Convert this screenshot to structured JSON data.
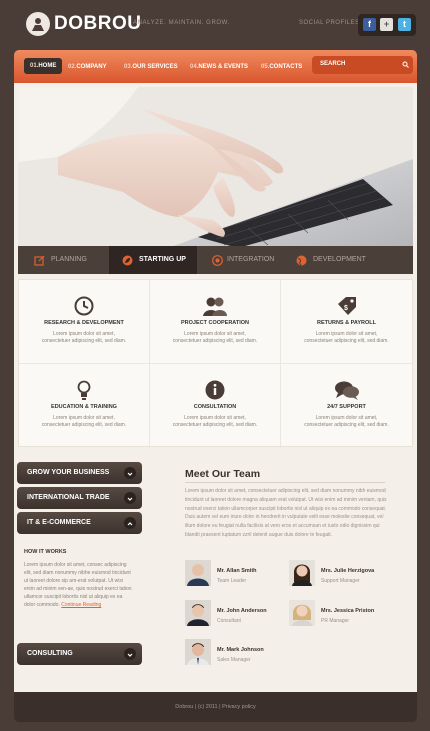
{
  "header": {
    "logo_text": "DOBROU",
    "slogan": "ANALYZE. MAINTAIN. GROW.",
    "social_label": "SOCIAL PROFILES",
    "social": [
      {
        "icon": "facebook-icon",
        "glyph": "f"
      },
      {
        "icon": "google-plus-icon",
        "glyph": "+"
      },
      {
        "icon": "twitter-icon",
        "glyph": "t"
      }
    ]
  },
  "nav": {
    "items": [
      {
        "num": "01.",
        "label": "HOME"
      },
      {
        "num": "02.",
        "label": "COMPANY"
      },
      {
        "num": "03.",
        "label": "OUR SERVICES"
      },
      {
        "num": "04.",
        "label": "NEWS & EVENTS"
      },
      {
        "num": "05.",
        "label": "CONTACTS"
      }
    ],
    "search_placeholder": "SEARCH"
  },
  "tabs": [
    {
      "label": "PLANNING",
      "icon": "edit-icon"
    },
    {
      "label": "STARTING UP",
      "icon": "leaf-icon"
    },
    {
      "label": "INTEGRATION",
      "icon": "target-icon"
    },
    {
      "label": "DEVELOPMENT",
      "icon": "globe-icon"
    }
  ],
  "features": [
    {
      "title": "RESEARCH & DEVELOPMENT",
      "text": "Lorem ipsum dolor sit amet, consectetuer adipiscing elit, sed diam.",
      "icon": "clock-icon"
    },
    {
      "title": "PROJECT COOPERATION",
      "text": "Lorem ipsum dolor sit amet, consectetuer adipiscing elit, sed diam.",
      "icon": "people-icon"
    },
    {
      "title": "RETURNS & PAYROLL",
      "text": "Lorem ipsum dolor sit amet, consectetuer adipiscing elit, sed diam.",
      "icon": "price-tag-icon"
    },
    {
      "title": "EDUCATION & TRAINING",
      "text": "Lorem ipsum dolor sit amet, consectetuer adipiscing elit, sed diam.",
      "icon": "lightbulb-icon"
    },
    {
      "title": "CONSULTATION",
      "text": "Lorem ipsum dolor sit amet, consectetuer adipiscing elit, sed diam.",
      "icon": "info-icon"
    },
    {
      "title": "24/7 SUPPORT",
      "text": "Lorem ipsum dolor sit amet, consectetuer adipiscing elit, sed diam.",
      "icon": "chat-bubbles-icon"
    }
  ],
  "accordion": {
    "items": [
      {
        "label": "GROW YOUR BUSINESS"
      },
      {
        "label": "INTERNATIONAL TRADE"
      },
      {
        "label": "IT & E-COMMERCE"
      },
      {
        "label": "CONSULTING"
      }
    ],
    "open_heading": "HOW IT WORKS",
    "open_text": "Lorem ipsum dolor sit amet, consec adipiscing elit, sed diam nonummy nibhe euismod tincidunt ut laoreet dolore sip am-erat volutpat. Ut wisi enim ad minim ven-ae, quis nostrud exerci tation ullamcor suscipit lobortis nisl ut aliquip ex ea dolor commodo.",
    "read_more": "Continue Reading"
  },
  "team": {
    "title": "Meet Our Team",
    "text": "Lorem ipsum dolor sit amet, consectetuer adipiscing elit, sed diam nonummy nibh euismod tincidunt ut laoreet dolore magna aliquam erat volutpat. Ut wisi enim ad minim veniam, quis nostrud exerci tation ullamcorper suscipit lobortis nisl ut aliquip ex ea commodo consequat. Duis autem vel eum iriure dolor in hendrerit in vulputate velit esse molestie consequat, vel illum dolore eu feugiat nulla facilisis at vero eros et accumsan et iusto odio dignissim qui blandit praesent luptatum zzril delenit augue duis dolore te feugait.",
    "members": [
      {
        "name": "Mr. Allan Smith",
        "role": "Team Leader"
      },
      {
        "name": "Mrs. Julie Herzigova",
        "role": "Support Manager"
      },
      {
        "name": "Mr. John Anderson",
        "role": "Consultant"
      },
      {
        "name": "Mrs. Jessica Priston",
        "role": "PR Manager"
      },
      {
        "name": "Mr. Mark Johnson",
        "role": "Sales Manager"
      }
    ]
  },
  "footer": {
    "text": "Dobrou  |  (c) 2011  |  Privacy policy"
  },
  "colors": {
    "accent": "#e0622f",
    "background": "#4a3d37",
    "panel": "#f4f0e9"
  }
}
